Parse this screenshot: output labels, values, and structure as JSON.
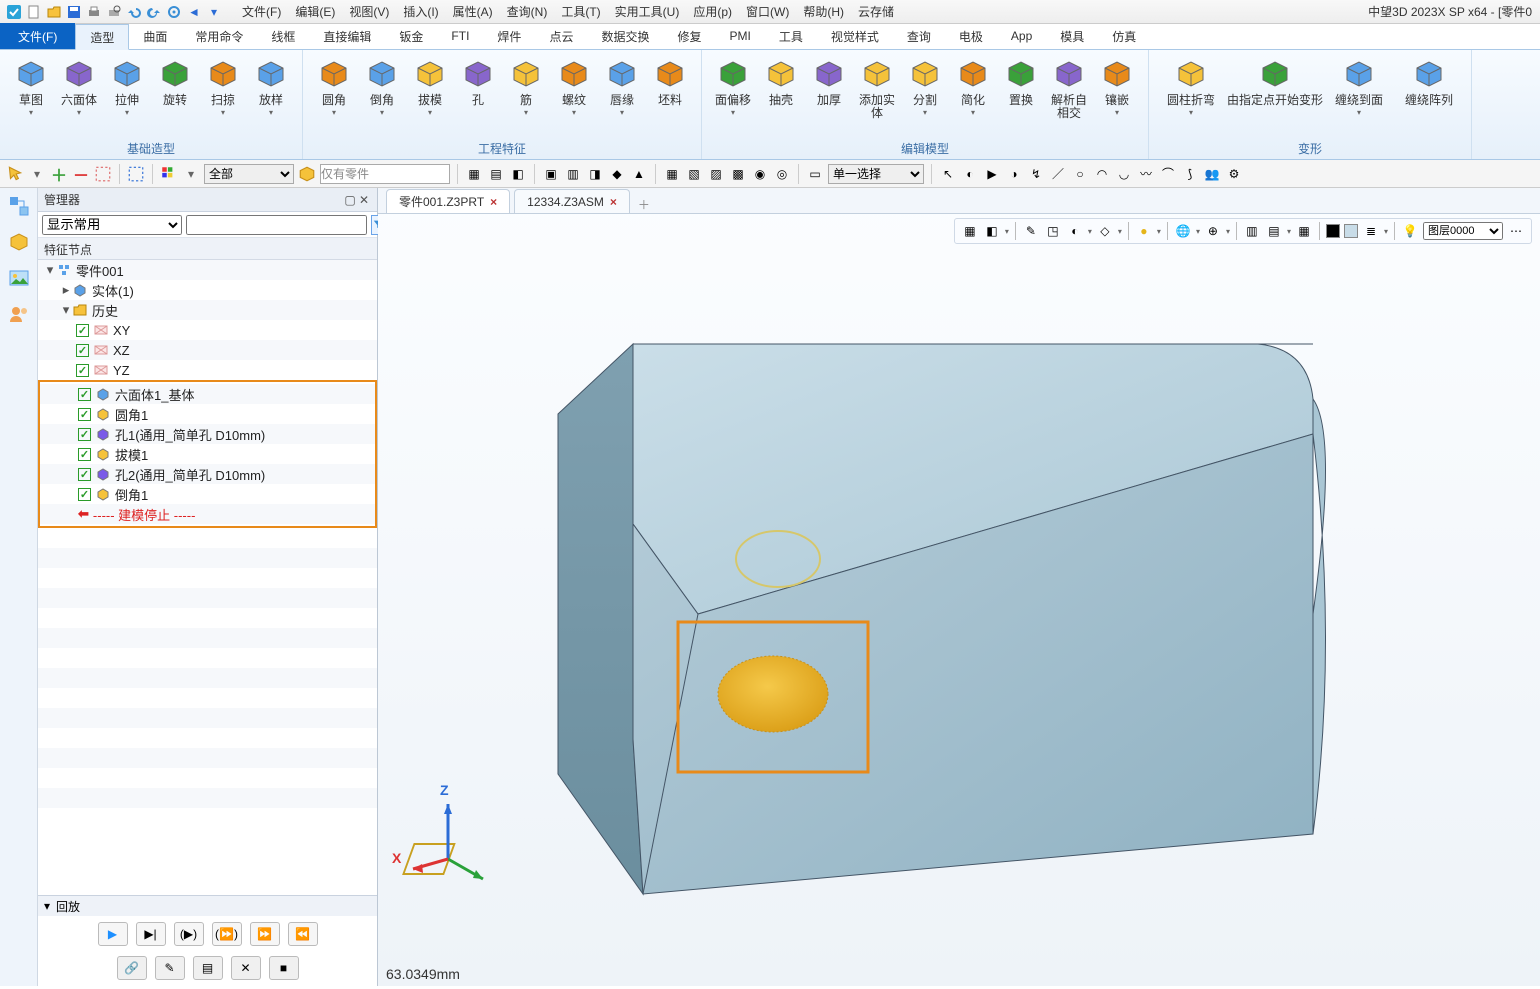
{
  "app_title": "中望3D 2023X SP x64 - [零件0",
  "menus": [
    "文件(F)",
    "编辑(E)",
    "视图(V)",
    "插入(I)",
    "属性(A)",
    "查询(N)",
    "工具(T)",
    "实用工具(U)",
    "应用(p)",
    "窗口(W)",
    "帮助(H)",
    "云存储"
  ],
  "ribbon_tabs": {
    "file": "文件(F)",
    "items": [
      "造型",
      "曲面",
      "常用命令",
      "线框",
      "直接编辑",
      "钣金",
      "FTI",
      "焊件",
      "点云",
      "数据交换",
      "修复",
      "PMI",
      "工具",
      "视觉样式",
      "查询",
      "电极",
      "App",
      "模具",
      "仿真"
    ],
    "active_index": 0
  },
  "ribbon_groups": [
    {
      "label": "基础造型",
      "buttons": [
        {
          "l": "草图",
          "dd": true
        },
        {
          "l": "六面体",
          "dd": true
        },
        {
          "l": "拉伸",
          "dd": true
        },
        {
          "l": "旋转"
        },
        {
          "l": "扫掠",
          "dd": true
        },
        {
          "l": "放样",
          "dd": true
        }
      ]
    },
    {
      "label": "工程特征",
      "buttons": [
        {
          "l": "圆角",
          "dd": true
        },
        {
          "l": "倒角",
          "dd": true
        },
        {
          "l": "拔模",
          "dd": true
        },
        {
          "l": "孔"
        },
        {
          "l": "筋",
          "dd": true
        },
        {
          "l": "螺纹",
          "dd": true
        },
        {
          "l": "唇缘",
          "dd": true
        },
        {
          "l": "坯料"
        }
      ]
    },
    {
      "label": "编辑模型",
      "buttons": [
        {
          "l": "面偏移",
          "dd": true
        },
        {
          "l": "抽壳"
        },
        {
          "l": "加厚"
        },
        {
          "l": "添加实体"
        },
        {
          "l": "分割",
          "dd": true
        },
        {
          "l": "简化",
          "dd": true
        },
        {
          "l": "置换"
        },
        {
          "l": "解析自相交"
        },
        {
          "l": "镶嵌",
          "dd": true
        }
      ]
    },
    {
      "label": "变形",
      "buttons": [
        {
          "l": "圆柱折弯",
          "dd": true,
          "w": "wide"
        },
        {
          "l": "由指定点开始变形",
          "w": "xwide"
        },
        {
          "l": "缠绕到面",
          "dd": true,
          "w": "wide"
        },
        {
          "l": "缠绕阵列",
          "w": "wide"
        }
      ]
    }
  ],
  "toolstrip": {
    "filter_all": "全部",
    "only_parts": "仅有零件",
    "selection_mode": "单一选择"
  },
  "panel": {
    "title": "管理器",
    "display_filter": "显示常用",
    "tree_head": "特征节点",
    "root": "零件001",
    "solid": "实体(1)",
    "history": "历史",
    "planes": [
      "XY",
      "XZ",
      "YZ"
    ],
    "features": [
      "六面体1_基体",
      "圆角1",
      "孔1(通用_简单孔 D10mm)",
      "拔模1",
      "孔2(通用_简单孔 D10mm)",
      "倒角1"
    ],
    "stop": "----- 建模停止 -----",
    "playback": "回放"
  },
  "doc_tabs": [
    {
      "name": "零件001.Z3PRT",
      "active": true
    },
    {
      "name": "12334.Z3ASM",
      "active": false
    }
  ],
  "view_toolbar": {
    "layer": "图层0000"
  },
  "readout": "63.0349mm",
  "axes": {
    "x": "X",
    "z": "Z"
  }
}
